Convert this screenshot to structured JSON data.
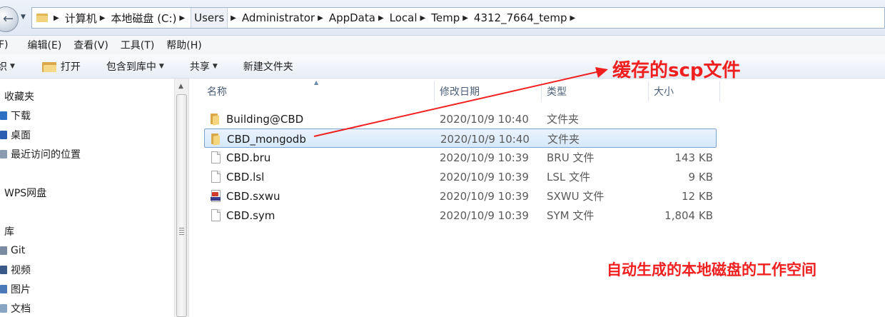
{
  "address_bar": {
    "crumbs": [
      "计算机",
      "本地磁盘 (C:)",
      "Users",
      "Administrator",
      "AppData",
      "Local",
      "Temp",
      "4312_7664_temp"
    ]
  },
  "menu": {
    "items": [
      "F)",
      "编辑(E)",
      "查看(V)",
      "工具(T)",
      "帮助(H)"
    ]
  },
  "toolbar": {
    "organize": "织",
    "open": "打开",
    "include_library": "包含到库中",
    "share": "共享",
    "new_folder": "新建文件夹"
  },
  "nav": {
    "favorites_header": "收藏夹",
    "favorites": [
      {
        "label": "下载",
        "icon": "download-icon",
        "color": "#2d6fc2"
      },
      {
        "label": "桌面",
        "icon": "desktop-icon",
        "color": "#2a5db0"
      },
      {
        "label": "最近访问的位置",
        "icon": "recent-places-icon",
        "color": "#8c9cb0"
      }
    ],
    "wps": "WPS网盘",
    "libraries_header": "库",
    "libraries": [
      {
        "label": "Git",
        "icon": "git-library-icon",
        "color": "#7a8aa0"
      },
      {
        "label": "视频",
        "icon": "videos-icon",
        "color": "#3a5a8a"
      },
      {
        "label": "图片",
        "icon": "pictures-icon",
        "color": "#4a7ab8"
      },
      {
        "label": "文档",
        "icon": "documents-icon",
        "color": "#8aa4c4"
      }
    ]
  },
  "columns": {
    "name": "名称",
    "date": "修改日期",
    "type": "类型",
    "size": "大小"
  },
  "files": [
    {
      "name": "Building@CBD",
      "date": "2020/10/9 10:40",
      "type": "文件夹",
      "size": "",
      "icon": "folder-icon",
      "selected": false
    },
    {
      "name": "CBD_mongodb",
      "date": "2020/10/9 10:40",
      "type": "文件夹",
      "size": "",
      "icon": "folder-icon",
      "selected": true
    },
    {
      "name": "CBD.bru",
      "date": "2020/10/9 10:39",
      "type": "BRU 文件",
      "size": "143 KB",
      "icon": "file-icon",
      "selected": false
    },
    {
      "name": "CBD.lsl",
      "date": "2020/10/9 10:39",
      "type": "LSL 文件",
      "size": "9 KB",
      "icon": "file-icon",
      "selected": false
    },
    {
      "name": "CBD.sxwu",
      "date": "2020/10/9 10:39",
      "type": "SXWU 文件",
      "size": "12 KB",
      "icon": "sxwu-file-icon",
      "selected": false
    },
    {
      "name": "CBD.sym",
      "date": "2020/10/9 10:39",
      "type": "SYM 文件",
      "size": "1,804 KB",
      "icon": "file-icon",
      "selected": false
    }
  ],
  "annotations": {
    "cache_label": "缓存的scp文件",
    "workspace_label": "自动生成的本地磁盘的工作空间",
    "color": "#f02020"
  }
}
